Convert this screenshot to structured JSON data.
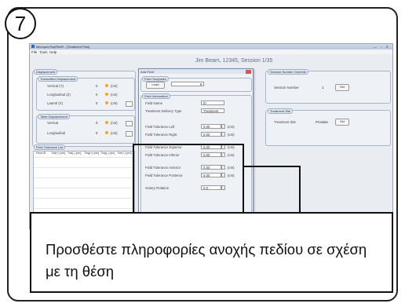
{
  "step_number": "7",
  "app": {
    "window_title": "Micropos RayPilot® - [Treatment Plan]",
    "menu": [
      "File",
      "Tools",
      "Help"
    ],
    "session_header": "Jim Beam, 12345, Session 1/35",
    "window_controls": "— ▫ ✕"
  },
  "displacement": {
    "section_label": "Displacement",
    "transmitter_label": "Transmitter Displacement",
    "table_label": "Table Displacement",
    "transmitter_rows": [
      {
        "label": "Vertical (Y)",
        "value": "0",
        "unit": "(cm)"
      },
      {
        "label": "Longitudinal (Z)",
        "value": "0",
        "unit": "(cm)"
      },
      {
        "label": "Lateral (X)",
        "value": "0",
        "unit": "(cm)"
      }
    ],
    "table_rows": [
      {
        "label": "Vertical",
        "value": "0",
        "unit": "(cm)"
      },
      {
        "label": "Longitudinal",
        "value": "0",
        "unit": "(cm)"
      }
    ]
  },
  "field_tolerance_list": {
    "label": "Field Tolerance List",
    "columns": [
      "Field ID",
      "Tlat(+) [cm]",
      "Tlat(-) [cm]",
      "Tlng(+) [cm]",
      "Tlng(-) [cm]",
      "Tvrt(+) [cm]"
    ]
  },
  "dialog": {
    "title": "Add Field",
    "templates_label": "Field Templates",
    "load_button": "Load",
    "info_label": "Field Information",
    "field_name_label": "Field Name",
    "field_name_value": "f0",
    "delivery_type_label": "Treatment Delivery Type",
    "delivery_type_value": "Treatment",
    "tolerances": [
      {
        "label": "Field Tolerance Left",
        "value": "0.00",
        "unit": "(cm)"
      },
      {
        "label": "Field Tolerance Right",
        "value": "0.00",
        "unit": "(cm)"
      },
      {
        "label": "Field Tolerance Superior",
        "value": "0.00",
        "unit": "(cm)"
      },
      {
        "label": "Field Tolerance Inferior",
        "value": "0.00",
        "unit": "(cm)"
      },
      {
        "label": "Field Tolerance Anterior",
        "value": "0.00",
        "unit": "(cm)"
      },
      {
        "label": "Field Tolerance Posterior",
        "value": "0.00",
        "unit": "(cm)"
      }
    ],
    "gantry_label": "Gantry Rotation",
    "gantry_value": "0.0"
  },
  "session_override": {
    "label": "Session Number Override",
    "field_label": "Session Number",
    "field_value": "1",
    "button": "Set"
  },
  "treatment_site": {
    "label": "Treatment Site",
    "field_label": "Treatment Site",
    "field_value": "Prostate",
    "button": "Set"
  },
  "callout_text": "Προσθέστε πληροφορίες ανοχής πεδίου σε σχέση με τη θέση"
}
